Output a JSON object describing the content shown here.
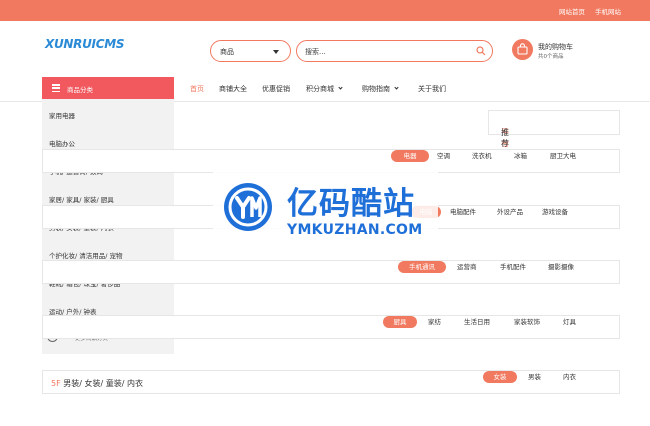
{
  "topbar": {
    "links": [
      "网站首页",
      "手机网站"
    ]
  },
  "header": {
    "logo_text": "XUNRUICMS",
    "search_select": "商品",
    "search_placeholder": "搜索...",
    "cart_title": "我的购物车",
    "cart_count": "共0个商品"
  },
  "nav": {
    "category_label": "商品分类",
    "items": [
      {
        "label": "首页",
        "active": true
      },
      {
        "label": "商铺大全"
      },
      {
        "label": "优惠促销"
      },
      {
        "label": "积分商城",
        "dropdown": true
      },
      {
        "label": "购物指南",
        "dropdown": true
      },
      {
        "label": "关于我们"
      }
    ]
  },
  "sidebar": {
    "items": [
      "家用电器",
      "电脑办公",
      "手机/ 运营商/ 数码",
      "家居/ 家具/ 家装/ 厨具",
      "男装/ 女装/ 童装/ 内衣",
      "个护化妆/ 清洁用品/ 宠物",
      "鞋靴/ 箱包/ 珠宝/ 奢侈品",
      "运动/ 户外/ 钟表"
    ],
    "more_label": "更多商品分类"
  },
  "recommend": {
    "highlight": "平台",
    "rest": " 推荐"
  },
  "floors": [
    {
      "title_num": "",
      "title": "",
      "tabs": [
        "电器",
        "空调",
        "洗衣机",
        "冰箱",
        "厨卫大电"
      ]
    },
    {
      "title_num": "",
      "title": "",
      "tabs": [
        "电脑",
        "电脑配件",
        "外设产品",
        "游戏设备"
      ]
    },
    {
      "title_num": "",
      "title": "",
      "tabs": [
        "手机通讯",
        "运营商",
        "手机配件",
        "摄影摄像"
      ]
    },
    {
      "title_num": "",
      "title": "",
      "tabs": [
        "厨具",
        "家纺",
        "生活日用",
        "家装软饰",
        "灯具"
      ]
    },
    {
      "title_num": "5F",
      "title": " 男装/ 女装/ 童装/ 内衣",
      "tabs": [
        "女装",
        "男装",
        "内衣"
      ]
    }
  ],
  "watermark": {
    "title": "亿码酷站",
    "subtitle": "YMKUZHAN.COM"
  },
  "colors": {
    "accent": "#f1795f",
    "category_header": "#f1595f",
    "watermark": "#1f6fd8"
  }
}
